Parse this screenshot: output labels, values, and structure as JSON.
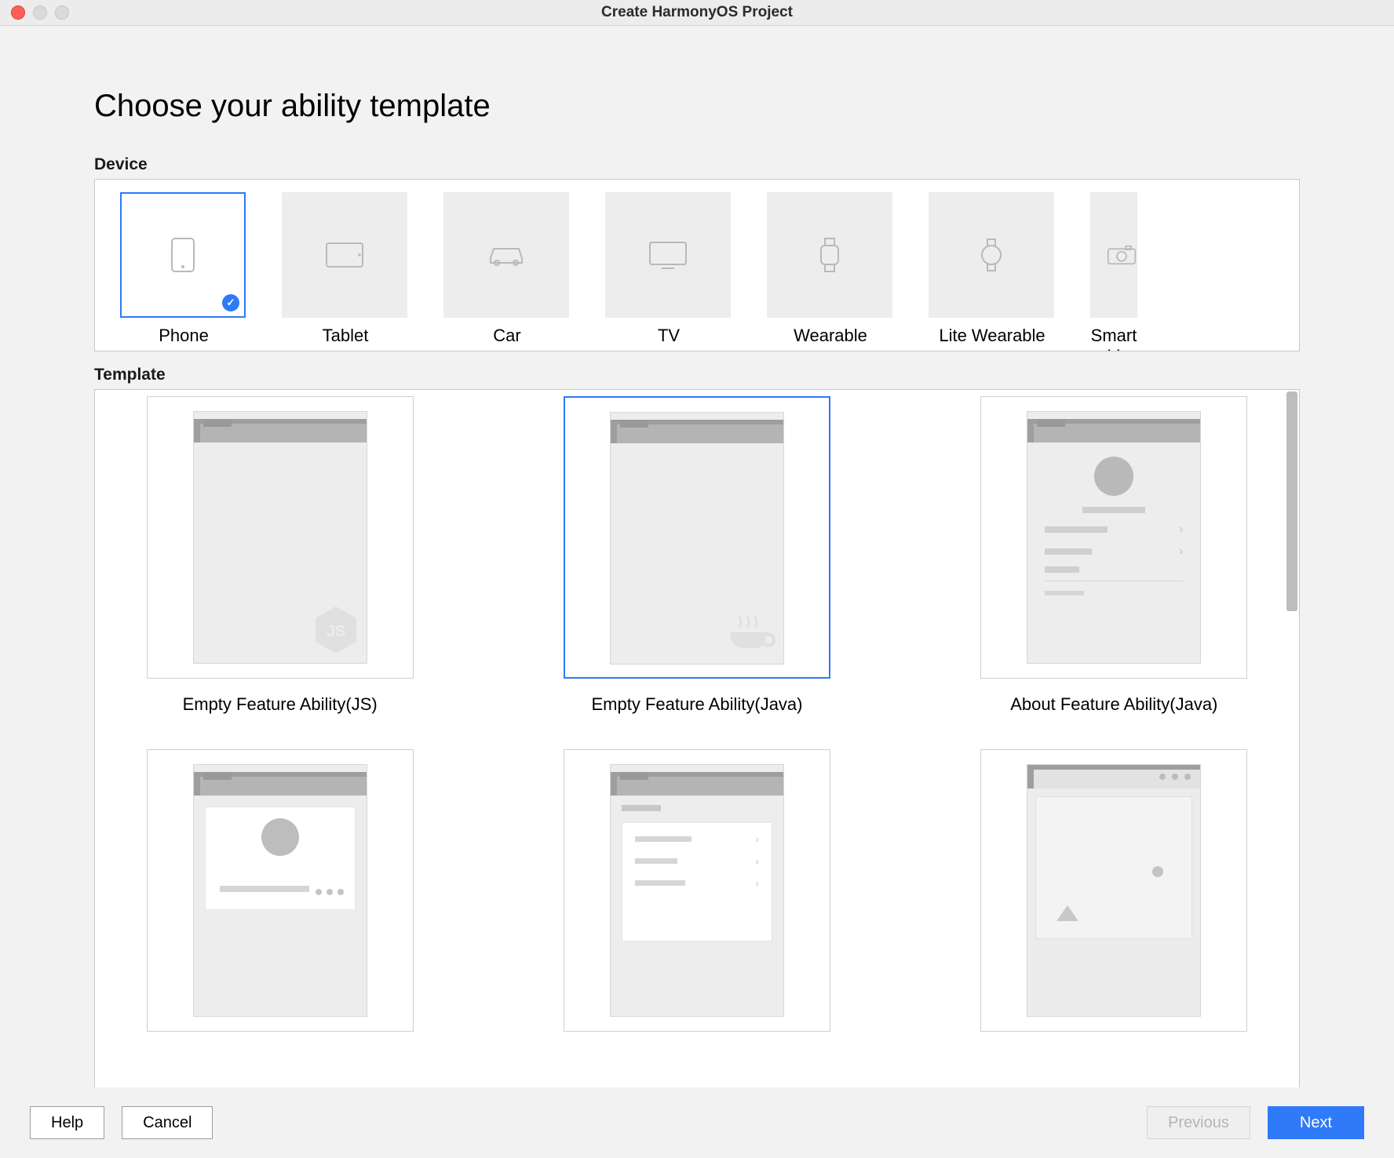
{
  "window": {
    "title": "Create HarmonyOS Project"
  },
  "header": {
    "title": "Choose your ability template"
  },
  "deviceSection": {
    "label": "Device",
    "items": [
      {
        "id": "phone",
        "label": "Phone",
        "icon": "phone-icon",
        "selected": true
      },
      {
        "id": "tablet",
        "label": "Tablet",
        "icon": "tablet-icon",
        "selected": false
      },
      {
        "id": "car",
        "label": "Car",
        "icon": "car-icon",
        "selected": false
      },
      {
        "id": "tv",
        "label": "TV",
        "icon": "tv-icon",
        "selected": false
      },
      {
        "id": "wearable",
        "label": "Wearable",
        "icon": "watch-icon",
        "selected": false
      },
      {
        "id": "lite-wearable",
        "label": "Lite Wearable",
        "icon": "watch-icon",
        "selected": false
      },
      {
        "id": "smart-vision",
        "label": "Smart V",
        "icon": "camera-icon",
        "selected": false
      }
    ]
  },
  "templateSection": {
    "label": "Template",
    "items": [
      {
        "id": "empty-js",
        "label": "Empty Feature Ability(JS)",
        "preview": "empty-js",
        "selected": false
      },
      {
        "id": "empty-java",
        "label": "Empty Feature Ability(Java)",
        "preview": "empty-java",
        "selected": true
      },
      {
        "id": "about-java",
        "label": "About Feature Ability(Java)",
        "preview": "about",
        "selected": false
      },
      {
        "id": "business",
        "label": "",
        "preview": "business",
        "selected": false
      },
      {
        "id": "category",
        "label": "",
        "preview": "category",
        "selected": false
      },
      {
        "id": "fullscreen",
        "label": "",
        "preview": "fullscreen",
        "selected": false
      }
    ]
  },
  "footer": {
    "help": "Help",
    "cancel": "Cancel",
    "previous": "Previous",
    "next": "Next",
    "previousEnabled": false
  }
}
